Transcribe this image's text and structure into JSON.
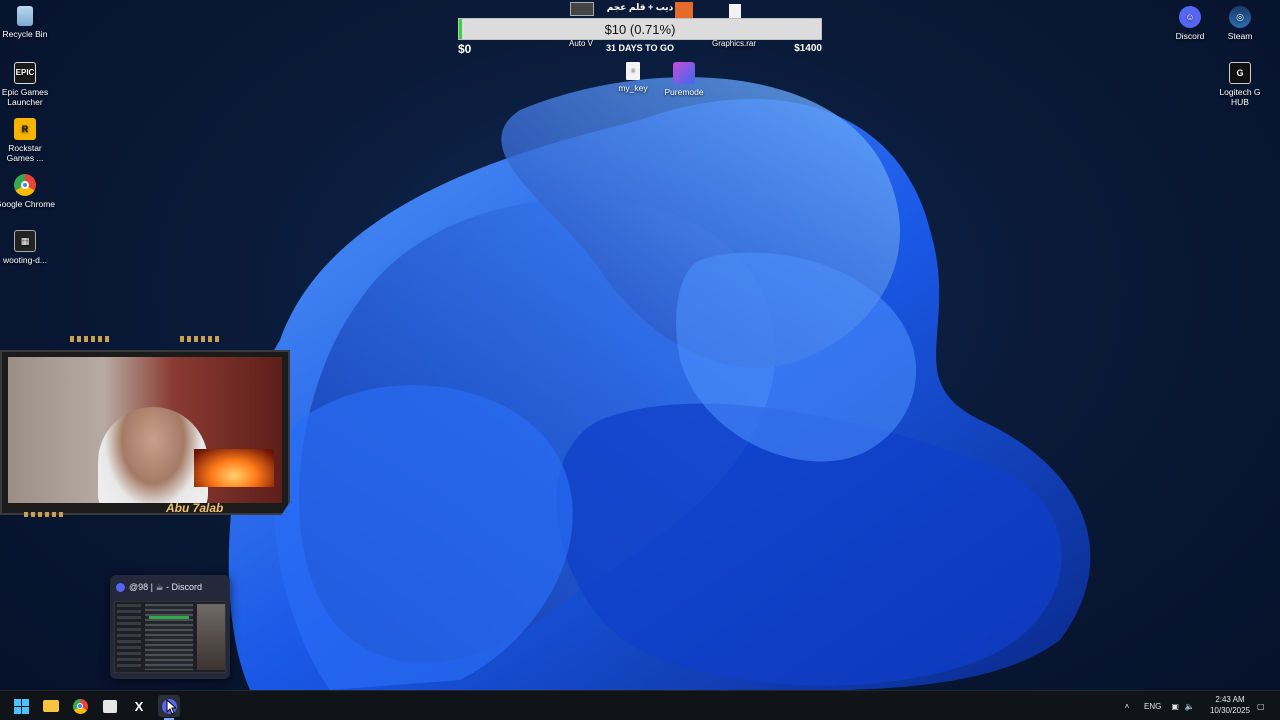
{
  "desktop_left": [
    {
      "label": "Recycle Bin",
      "icon": "recycle-bin-icon"
    },
    {
      "label": "Epic Games Launcher",
      "icon": "epic-games-icon"
    },
    {
      "label": "Rockstar Games ...",
      "icon": "rockstar-icon"
    },
    {
      "label": "Google Chrome",
      "icon": "chrome-icon"
    },
    {
      "label": "wooting-d...",
      "icon": "wooting-icon"
    }
  ],
  "desktop_right": [
    {
      "label": "Discord",
      "icon": "discord-icon"
    },
    {
      "label": "Steam",
      "icon": "steam-icon"
    },
    {
      "label": "Logitech G HUB",
      "icon": "logitech-icon"
    }
  ],
  "desktop_center": [
    {
      "label": "my_key",
      "icon": "text-file-icon"
    },
    {
      "label": "Puremode",
      "icon": "puremode-icon"
    }
  ],
  "top_strip": {
    "arabic_text": "ديب + قلم عجم",
    "auto_label": "Auto V",
    "graphics_label": "Graphics.rar"
  },
  "goal": {
    "value_text": "$10 (0.71%)",
    "progress_percent": 0.71,
    "min_label": "$0",
    "days_label": "31 DAYS TO GO",
    "max_label": "$1400",
    "fill_color": "#3ecf4a"
  },
  "webcam": {
    "streamer_name": "Abu 7alab"
  },
  "preview": {
    "title": "@98 | ☕ - Discord"
  },
  "taskbar": {
    "apps": [
      {
        "name": "start-button",
        "icon": "windows-icon"
      },
      {
        "name": "file-explorer",
        "icon": "folder-icon"
      },
      {
        "name": "chrome",
        "icon": "chrome-icon"
      },
      {
        "name": "store",
        "icon": "store-icon"
      },
      {
        "name": "x",
        "icon": "x-icon"
      },
      {
        "name": "discord",
        "icon": "discord-icon"
      }
    ],
    "lang": "ENG",
    "time": "2:43 AM",
    "date": "10/30/2025"
  }
}
